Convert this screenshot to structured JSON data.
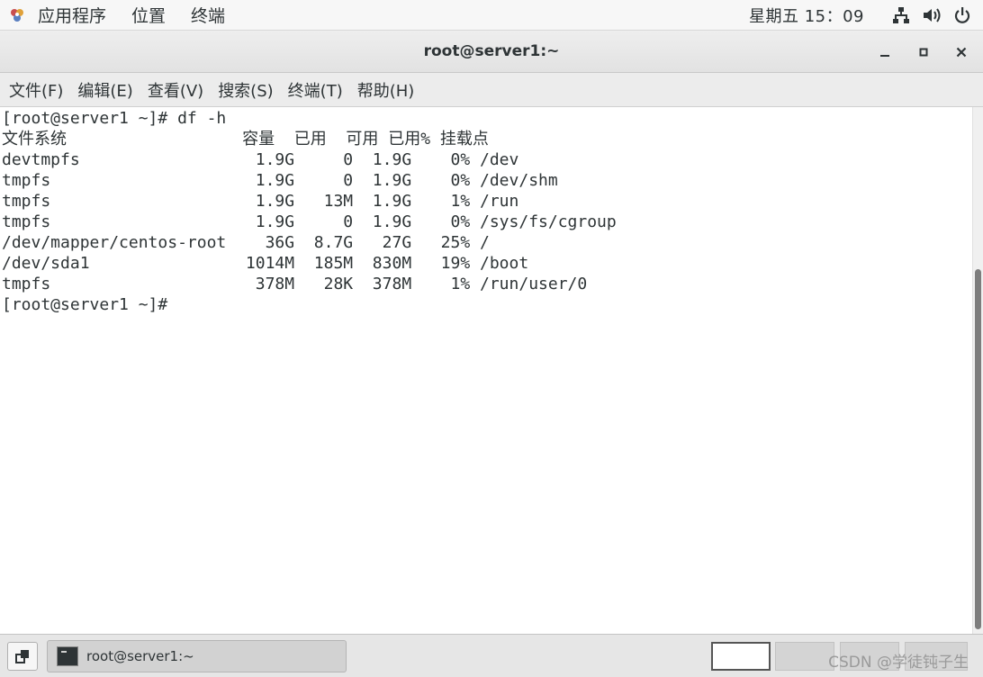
{
  "top_panel": {
    "apps_label": "应用程序",
    "places_label": "位置",
    "terminal_label": "终端",
    "clock": "星期五 15：09"
  },
  "window": {
    "title": "root@server1:~"
  },
  "menubar": {
    "items": [
      "文件(F)",
      "编辑(E)",
      "查看(V)",
      "搜索(S)",
      "终端(T)",
      "帮助(H)"
    ]
  },
  "terminal": {
    "lines": [
      "[root@server1 ~]# df -h",
      "文件系统                  容量  已用  可用 已用% 挂载点",
      "devtmpfs                  1.9G     0  1.9G    0% /dev",
      "tmpfs                     1.9G     0  1.9G    0% /dev/shm",
      "tmpfs                     1.9G   13M  1.9G    1% /run",
      "tmpfs                     1.9G     0  1.9G    0% /sys/fs/cgroup",
      "/dev/mapper/centos-root    36G  8.7G   27G   25% /",
      "/dev/sda1                1014M  185M  830M   19% /boot",
      "tmpfs                     378M   28K  378M    1% /run/user/0",
      "[root@server1 ~]#"
    ]
  },
  "taskbar": {
    "task_label": "root@server1:~",
    "watermark": "CSDN @学徒钝子生"
  }
}
